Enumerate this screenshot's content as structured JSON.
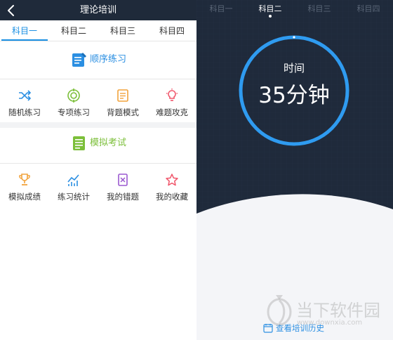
{
  "left": {
    "title": "理论培训",
    "tabs": [
      {
        "label": "科目一",
        "active": true
      },
      {
        "label": "科目二",
        "active": false
      },
      {
        "label": "科目三",
        "active": false
      },
      {
        "label": "科目四",
        "active": false
      }
    ],
    "practice": {
      "header": "顺序练习",
      "header_color": "#2b8fe2",
      "items": [
        {
          "label": "随机练习",
          "icon": "shuffle-icon",
          "color": "#2b8fe2"
        },
        {
          "label": "专项练习",
          "icon": "target-icon",
          "color": "#7cbf3a"
        },
        {
          "label": "背题模式",
          "icon": "checklist-icon",
          "color": "#f2a33c"
        },
        {
          "label": "难题攻克",
          "icon": "lightbulb-icon",
          "color": "#f0556a"
        }
      ]
    },
    "exam": {
      "header": "模拟考试",
      "header_color": "#7cbf3a",
      "items": [
        {
          "label": "模拟成绩",
          "icon": "trophy-icon",
          "color": "#f2a33c"
        },
        {
          "label": "练习统计",
          "icon": "trend-chart-icon",
          "color": "#2b8fe2"
        },
        {
          "label": "我的错题",
          "icon": "wrong-notes-icon",
          "color": "#9b59d0"
        },
        {
          "label": "我的收藏",
          "icon": "star-icon",
          "color": "#f0556a"
        }
      ]
    }
  },
  "right": {
    "tabs": [
      {
        "label": "科目一",
        "active": false
      },
      {
        "label": "科目二",
        "active": true
      },
      {
        "label": "科目三",
        "active": false
      },
      {
        "label": "科目四",
        "active": false
      }
    ],
    "timer_caption": "时间",
    "timer_value": "35分钟",
    "ring_color": "#2f9bf0",
    "history_link": "查看培训历史"
  },
  "watermark": {
    "brand": "当下软件园",
    "url": "www.downxia.com"
  }
}
